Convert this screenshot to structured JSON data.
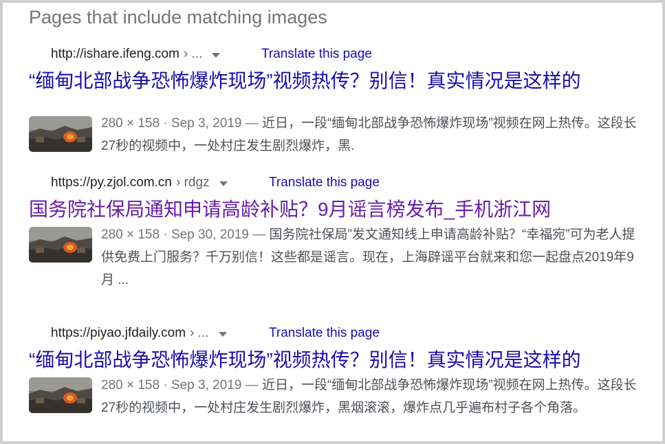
{
  "section_title": "Pages that include matching images",
  "results": [
    {
      "url": "http://ishare.ifeng.com",
      "path": "› ...",
      "translate": "Translate this page",
      "title": "“缅甸北部战争恐怖爆炸现场”视频热传？别信！真实情况是这样的",
      "meta": "280 × 158 · Sep 3, 2019 —",
      "snippet": "近日，一段“缅甸北部战争恐怖爆炸现场”视频在网上热传。这段长27秒的视频中，一处村庄发生剧烈爆炸，黑."
    },
    {
      "url": "https://py.zjol.com.cn",
      "path": "› rdgz",
      "translate": "Translate this page",
      "title": "国务院社保局通知申请高龄补贴？9月谣言榜发布_手机浙江网",
      "meta": "280 × 158 · Sep 30, 2019 —",
      "snippet": "国务院社保局”发文通知线上申请高龄补贴？“幸福宛”可为老人提供免费上门服务？千万别信！这些都是谣言。现在，上海辟谣平台就来和您一起盘点2019年9月 ..."
    },
    {
      "url": "https://piyao.jfdaily.com",
      "path": "› ...",
      "translate": "Translate this page",
      "title": "“缅甸北部战争恐怖爆炸现场”视频热传？别信！真实情况是这样的",
      "meta": "280 × 158 · Sep 3, 2019 —",
      "snippet": "近日，一段“缅甸北部战争恐怖爆炸现场”视频在网上热传。这段长27秒的视频中，一处村庄发生剧烈爆炸，黑烟滚滚，爆炸点几乎遍布村子各个角落。"
    }
  ]
}
